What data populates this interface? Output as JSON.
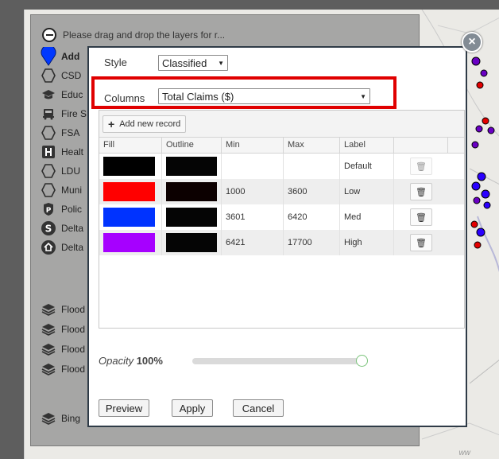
{
  "layer_panel": {
    "hint": "Please drag and drop the layers for r...",
    "items": [
      {
        "label": "Add",
        "icon": "pin-icon",
        "bold": true
      },
      {
        "label": "CSD",
        "icon": "hexagon-icon"
      },
      {
        "label": "Educ",
        "icon": "graduation-cap-icon"
      },
      {
        "label": "Fire S",
        "icon": "fire-truck-icon"
      },
      {
        "label": "FSA",
        "icon": "hexagon-icon"
      },
      {
        "label": "Healt",
        "icon": "hospital-icon"
      },
      {
        "label": "LDU",
        "icon": "hexagon-icon"
      },
      {
        "label": "Muni",
        "icon": "hexagon-icon"
      },
      {
        "label": "Polic",
        "icon": "police-badge-icon"
      },
      {
        "label": "Delta",
        "icon": "s-circle-icon"
      },
      {
        "label": "Delta",
        "icon": "house-circle-icon"
      },
      {
        "label": "Flood",
        "icon": "stack-icon"
      },
      {
        "label": "Flood",
        "icon": "stack-icon"
      },
      {
        "label": "Flood",
        "icon": "stack-icon"
      },
      {
        "label": "Flood",
        "icon": "stack-icon"
      },
      {
        "label": "Bing",
        "icon": "stack-icon"
      }
    ]
  },
  "dialog": {
    "style_label": "Style",
    "style_value": "Classified",
    "columns_label": "Columns",
    "columns_value": "Total Claims ($)",
    "add_record_label": "Add new record",
    "headers": [
      "Fill",
      "Outline",
      "Min",
      "Max",
      "Label"
    ],
    "rows": [
      {
        "fill": "#000000",
        "outline": "#050505",
        "min": "",
        "max": "",
        "label": "Default"
      },
      {
        "fill": "#ff0000",
        "outline": "#0c0000",
        "min": "1000",
        "max": "3600",
        "label": "Low"
      },
      {
        "fill": "#0033ff",
        "outline": "#050505",
        "min": "3601",
        "max": "6420",
        "label": "Med"
      },
      {
        "fill": "#a600ff",
        "outline": "#050505",
        "min": "6421",
        "max": "17700",
        "label": "High"
      }
    ],
    "opacity_label": "Opacity",
    "opacity_value": "100%",
    "opacity_level": 1.0,
    "preview_label": "Preview",
    "apply_label": "Apply",
    "cancel_label": "Cancel",
    "close_label": "×"
  },
  "map": {
    "watermark": "ww"
  }
}
